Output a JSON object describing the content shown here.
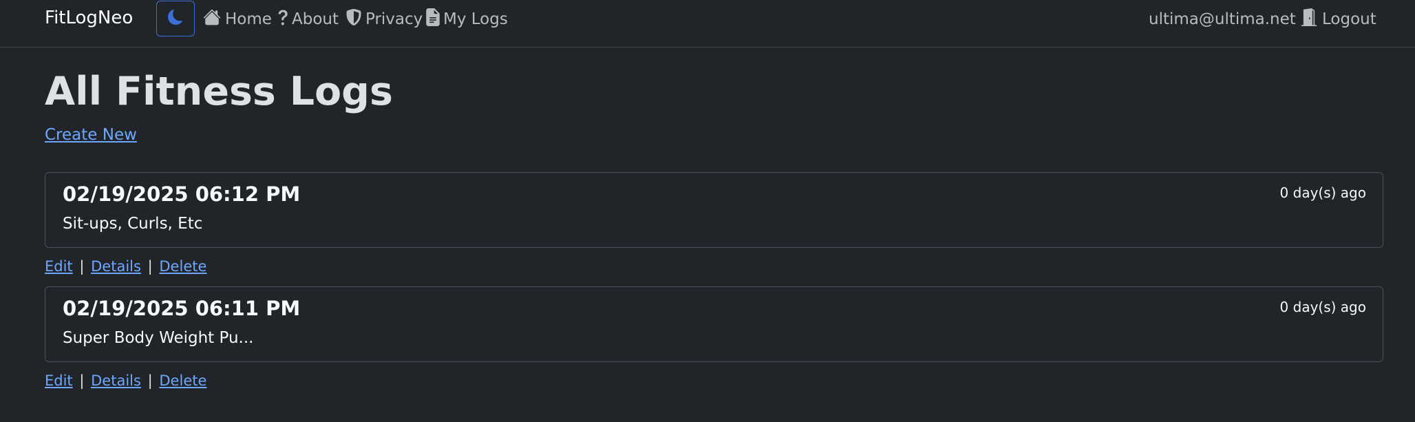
{
  "nav": {
    "brand": "FitLogNeo",
    "links": [
      {
        "label": "Home",
        "icon": "home-icon"
      },
      {
        "label": "About",
        "icon": "question-icon"
      },
      {
        "label": "Privacy",
        "icon": "shield-icon"
      },
      {
        "label": "My Logs",
        "icon": "document-icon"
      }
    ],
    "user_email": "ultima@ultima.net",
    "logout_label": "Logout",
    "theme_toggle_icon": "moon-icon"
  },
  "page": {
    "title": "All Fitness Logs",
    "create_new": "Create New"
  },
  "logs": [
    {
      "date": "02/19/2025 06:12 PM",
      "description": "Sit-ups, Curls, Etc",
      "ago": "0 day(s) ago"
    },
    {
      "date": "02/19/2025 06:11 PM",
      "description": "Super Body Weight Pu...",
      "ago": "0 day(s) ago"
    }
  ],
  "actions": {
    "edit": "Edit",
    "details": "Details",
    "delete": "Delete",
    "separator": "|"
  },
  "colors": {
    "background": "#212529",
    "link": "#6ea8fe",
    "toggle_border": "#3d6fd9",
    "moon": "#3d6fd9"
  }
}
